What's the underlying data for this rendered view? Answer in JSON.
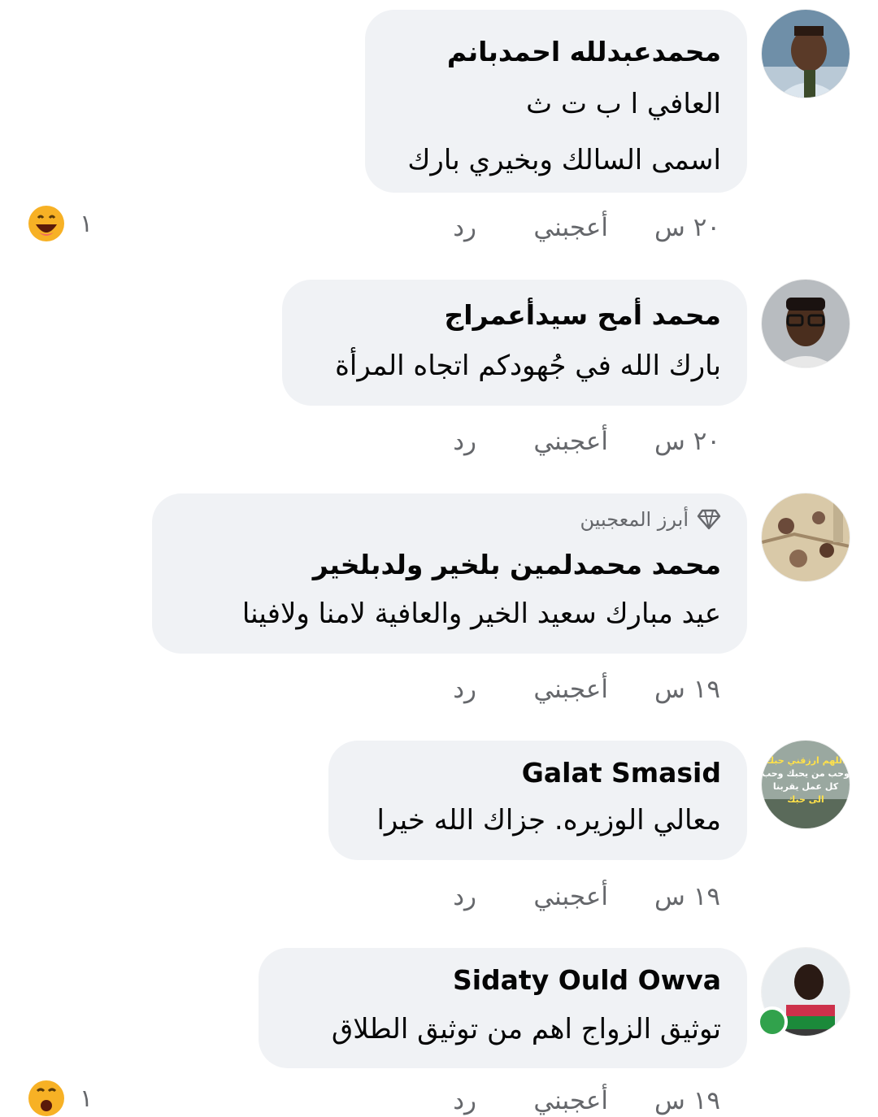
{
  "comments": [
    {
      "author": "محمدعبدلله احمدبانم",
      "lines": [
        "العافي ا ب ت ث",
        "اسمى السالك وبخيري بارك"
      ],
      "time": "٢٠ س",
      "like_label": "أعجبني",
      "reply_label": "رد",
      "reaction": {
        "icon": "laughing-emoji-icon",
        "count": "١"
      }
    },
    {
      "author": "محمد أمح سيدأعمراج",
      "lines": [
        "بارك الله في جُهودكم اتجاه المرأة"
      ],
      "time": "٢٠ س",
      "like_label": "أعجبني",
      "reply_label": "رد"
    },
    {
      "badge": "أبرز المعجبين",
      "author": "محمد محمدلمين بلخير ولدبلخير",
      "lines": [
        "عيد مبارك سعيد الخير والعافية لامنا ولافينا"
      ],
      "time": "١٩ س",
      "like_label": "أعجبني",
      "reply_label": "رد"
    },
    {
      "author": "Galat Smasid",
      "lines": [
        "معالي الوزيره. جزاك الله خيرا"
      ],
      "time": "١٩ س",
      "like_label": "أعجبني",
      "reply_label": "رد",
      "avatar_text": [
        "اللهم ارزقني حبك",
        "وحب من يحبك وحب",
        "كل عمل يقربنا",
        "الى حبك"
      ]
    },
    {
      "author": "Sidaty Ould Owva",
      "lines": [
        "توثيق الزواج اهم من توثيق الطلاق"
      ],
      "time": "١٩ س",
      "like_label": "أعجبني",
      "reply_label": "رد",
      "reaction": {
        "icon": "wow-emoji-icon",
        "count": "١"
      }
    }
  ],
  "colors": {
    "bubble": "#f0f2f5",
    "meta_text": "#65676b",
    "online": "#31a24c",
    "emoji_yellow": "#f7b125"
  }
}
